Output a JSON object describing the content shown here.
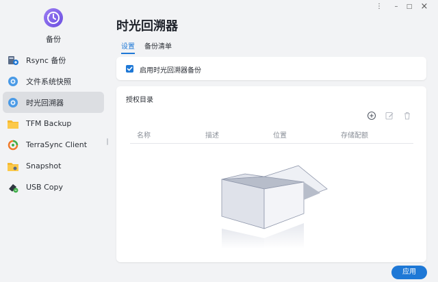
{
  "app": {
    "name": "备份",
    "icon": "clock-back-icon"
  },
  "window_controls": {
    "more": "⋮",
    "minimize": "–",
    "maximize": "□",
    "close": "×"
  },
  "sidebar": {
    "items": [
      {
        "label": "Rsync 备份",
        "icon": "rsync-icon",
        "active": false
      },
      {
        "label": "文件系统快照",
        "icon": "snapshot-gear-icon",
        "active": false
      },
      {
        "label": "时光回溯器",
        "icon": "time-machine-gear-icon",
        "active": true
      },
      {
        "label": "TFM Backup",
        "icon": "folder-icon",
        "active": false
      },
      {
        "label": "TerraSync Client",
        "icon": "terrasync-icon",
        "active": false
      },
      {
        "label": "Snapshot",
        "icon": "snapshot-folder-icon",
        "active": false
      },
      {
        "label": "USB Copy",
        "icon": "usb-icon",
        "active": false
      }
    ]
  },
  "main": {
    "title": "时光回溯器",
    "tabs": [
      {
        "label": "设置",
        "active": true
      },
      {
        "label": "备份清单",
        "active": false
      }
    ],
    "enable_checkbox": {
      "label": "启用时光回溯器备份",
      "checked": true
    },
    "auth_section": {
      "title": "授权目录",
      "tools": [
        "add-icon",
        "edit-icon",
        "delete-icon"
      ],
      "columns": [
        "名称",
        "描述",
        "位置",
        "存储配额"
      ],
      "rows": []
    },
    "apply_label": "应用"
  },
  "colors": {
    "accent": "#1e78d6",
    "active_nav": "#dcdee2",
    "background": "#f2f3f5"
  }
}
